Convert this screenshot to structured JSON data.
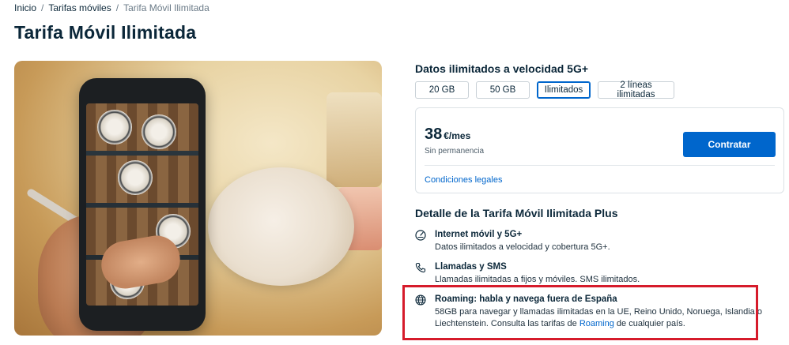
{
  "breadcrumb": {
    "items": [
      "Inicio",
      "Tarifas móviles",
      "Tarifa Móvil Ilimitada"
    ],
    "separator": "/"
  },
  "page_title": "Tarifa Móvil Ilimitada",
  "plans": {
    "title": "Datos ilimitados a velocidad 5G+",
    "options": [
      "20 GB",
      "50 GB",
      "Ilimitados",
      "2 líneas ilimitadas"
    ],
    "selected": "Ilimitados"
  },
  "price_card": {
    "amount": "38",
    "unit": "€/mes",
    "note": "Sin permanencia",
    "cta": "Contratar",
    "legal_link": "Condiciones legales"
  },
  "details": {
    "title": "Detalle de la Tarifa Móvil Ilimitada Plus",
    "features": [
      {
        "icon": "speedometer-icon",
        "title": "Internet móvil y 5G+",
        "description": "Datos ilimitados a velocidad y cobertura 5G+."
      },
      {
        "icon": "phone-icon",
        "title": "Llamadas y SMS",
        "description": "Llamadas ilimitadas a fijos y móviles. SMS ilimitados."
      },
      {
        "icon": "globe-icon",
        "title": "Roaming: habla y navega fuera de España",
        "description_before": "58GB para navegar y llamadas ilimitadas en la UE, Reino Unido, Noruega, Islandia o Liechtenstein. Consulta las tarifas de ",
        "description_link": "Roaming",
        "description_after": " de cualquier país."
      }
    ]
  },
  "colors": {
    "primary": "#0066cc",
    "text": "#0b2739",
    "highlight": "#d61b2b"
  }
}
